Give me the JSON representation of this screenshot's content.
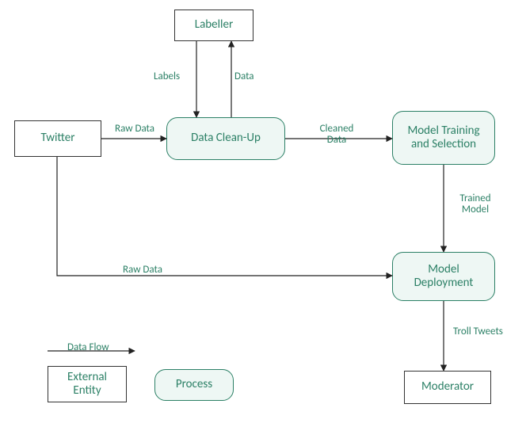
{
  "nodes": {
    "labeller": "Labeller",
    "twitter": "Twitter",
    "cleanup": "Data Clean-Up",
    "training": "Model Training and Selection",
    "deploy": "Model Deployment",
    "moderator": "Moderator"
  },
  "edges": {
    "labels": "Labels",
    "data_to_lab": "Data",
    "raw1": "Raw Data",
    "cleaned": "Cleaned Data",
    "trained": "Trained Model",
    "raw2": "Raw Data",
    "troll": "Troll Tweets"
  },
  "legend": {
    "dataflow": "Data Flow",
    "entity": "External Entity",
    "process": "Process"
  }
}
